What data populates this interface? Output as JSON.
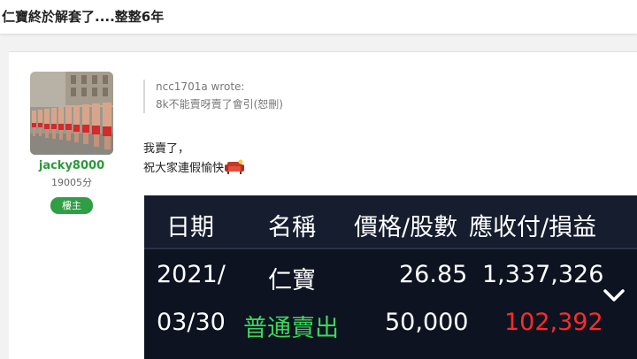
{
  "page": {
    "title": "仁寶終於解套了....整整6年"
  },
  "author": {
    "username": "jacky8000",
    "points": "19005分",
    "badge": "樓主"
  },
  "quote": {
    "author": "ncc1701a wrote:",
    "text": "8k不能賣呀賣了會引(恕刪)"
  },
  "post": {
    "line1": "我賣了，",
    "line2": "祝大家連假愉快"
  },
  "stock_table": {
    "headers": [
      "日期",
      "名稱",
      "價格/股數",
      "應收付/損益"
    ],
    "row": {
      "date_year": "2021/",
      "date_day": "03/30",
      "name": "仁寶",
      "action": "普通賣出",
      "price": "26.85",
      "shares": "50,000",
      "receivable": "1,337,326",
      "profit": "102,392"
    }
  },
  "icons": {
    "emoji": "couch-icon",
    "expand": "chevron-down-icon"
  },
  "colors": {
    "username": "#2a9a3a",
    "badge": "#2f9e44",
    "action": "#3dd65c",
    "profit": "#ff2a2a",
    "table_bg": "#0d1320"
  }
}
